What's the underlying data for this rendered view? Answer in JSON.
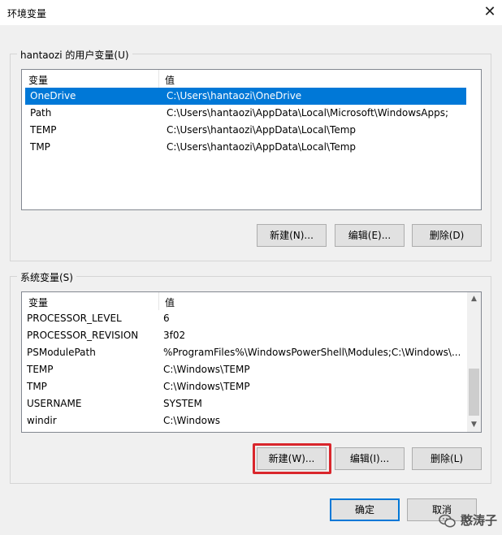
{
  "window": {
    "title": "环境变量",
    "close_glyph": "✕"
  },
  "user_vars": {
    "group_label": "hantaozi 的用户变量(U)",
    "headers": [
      "变量",
      "值"
    ],
    "rows": [
      {
        "name": "OneDrive",
        "value": "C:\\Users\\hantaozi\\OneDrive",
        "selected": true
      },
      {
        "name": "Path",
        "value": "C:\\Users\\hantaozi\\AppData\\Local\\Microsoft\\WindowsApps;"
      },
      {
        "name": "TEMP",
        "value": "C:\\Users\\hantaozi\\AppData\\Local\\Temp"
      },
      {
        "name": "TMP",
        "value": "C:\\Users\\hantaozi\\AppData\\Local\\Temp"
      }
    ],
    "buttons": {
      "new": "新建(N)...",
      "edit": "编辑(E)...",
      "delete": "删除(D)"
    }
  },
  "system_vars": {
    "group_label": "系统变量(S)",
    "headers": [
      "变量",
      "值"
    ],
    "rows": [
      {
        "name": "PROCESSOR_LEVEL",
        "value": "6"
      },
      {
        "name": "PROCESSOR_REVISION",
        "value": "3f02"
      },
      {
        "name": "PSModulePath",
        "value": "%ProgramFiles%\\WindowsPowerShell\\Modules;C:\\Windows\\..."
      },
      {
        "name": "TEMP",
        "value": "C:\\Windows\\TEMP"
      },
      {
        "name": "TMP",
        "value": "C:\\Windows\\TEMP"
      },
      {
        "name": "USERNAME",
        "value": "SYSTEM"
      },
      {
        "name": "windir",
        "value": "C:\\Windows"
      }
    ],
    "buttons": {
      "new": "新建(W)...",
      "edit": "编辑(I)...",
      "delete": "删除(L)"
    }
  },
  "footer": {
    "ok": "确定",
    "cancel": "取消"
  },
  "watermark": {
    "text": "憨涛子",
    "icon": "wechat-icon"
  },
  "colors": {
    "selection": "#0078d7",
    "highlight_box": "#d9262c",
    "primary_border": "#0078d7"
  }
}
